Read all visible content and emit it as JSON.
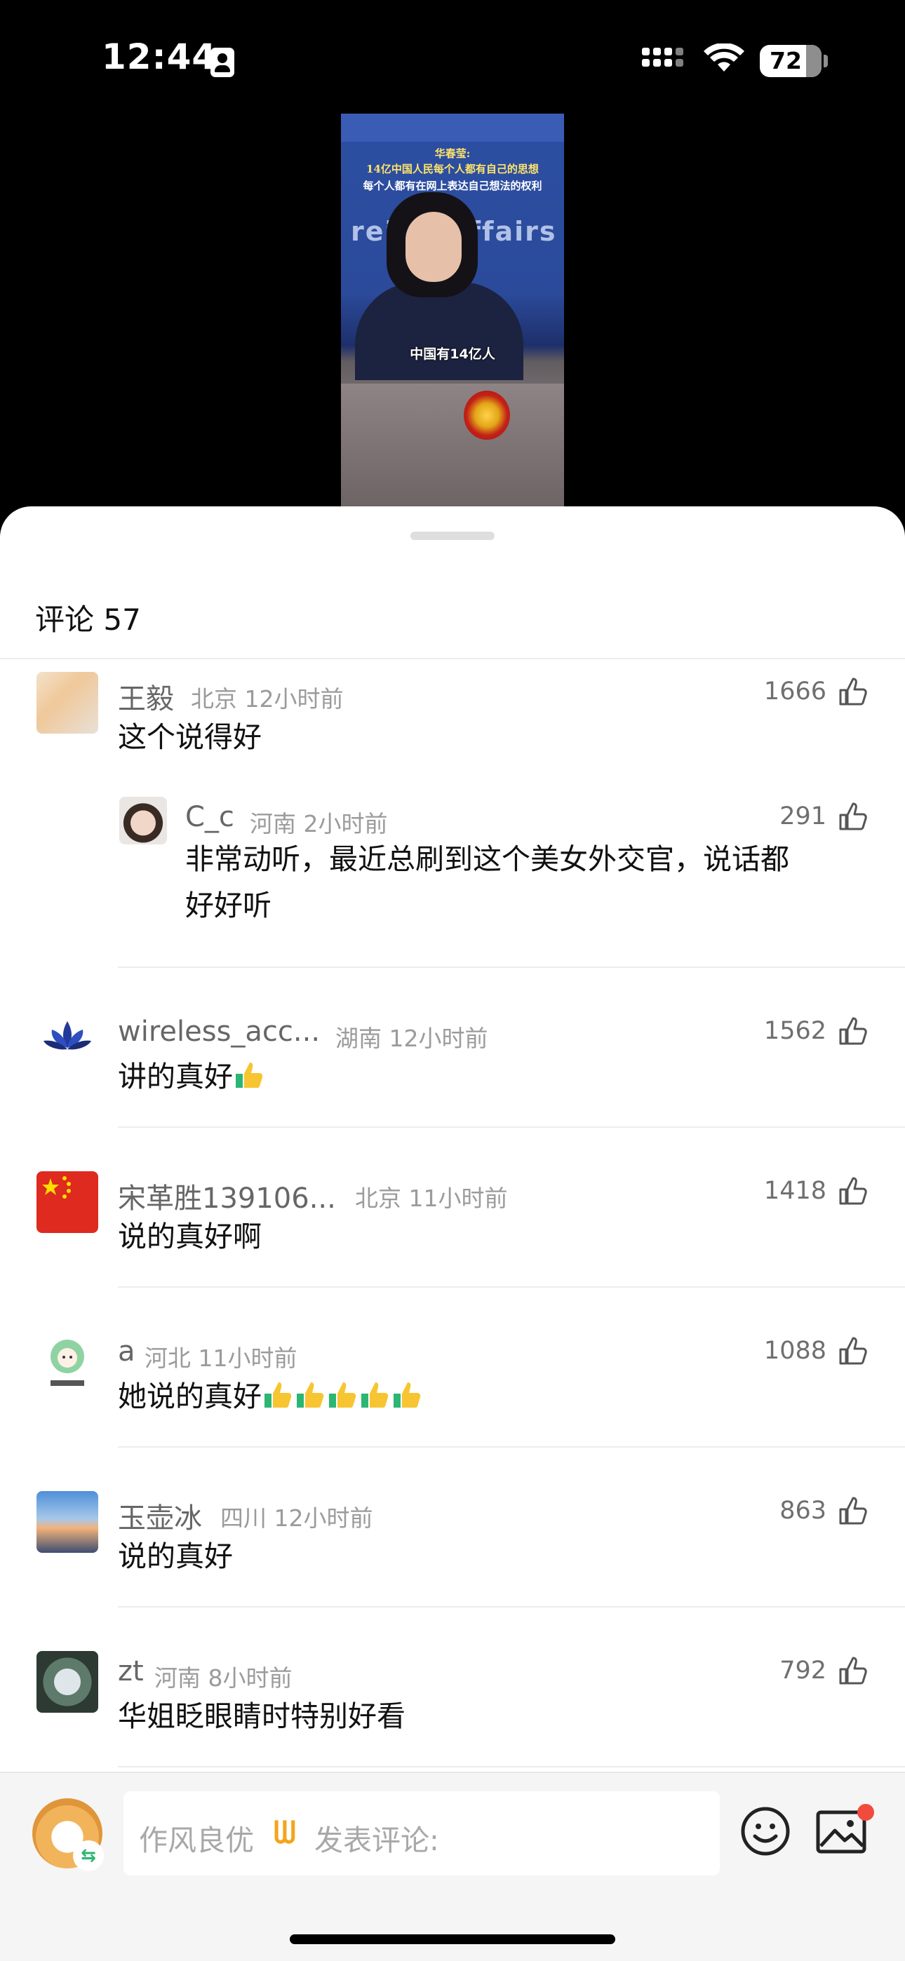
{
  "status_bar": {
    "time": "12:44",
    "battery": "72"
  },
  "video": {
    "caption_head": "华春莹:",
    "caption_line1": "14亿中国人民每个人都有自己的思想",
    "caption_line2": "每个人都有在网上表达自己想法的权利",
    "background_text": "reign Affairs",
    "subtitle": "中国有14亿人"
  },
  "comments_header": {
    "title": "评论 57"
  },
  "comments": [
    {
      "name": "王毅",
      "location": "北京",
      "time": "12小时前",
      "likes": "1666",
      "text": "这个说得好"
    },
    {
      "name": "C_c",
      "location": "河南",
      "time": "2小时前",
      "likes": "291",
      "text_line1": "非常动听，最近总刷到这个美女外交官，说话都",
      "text_line2": "好好听",
      "is_reply": true
    },
    {
      "name": "wireless_acc...",
      "location": "湖南",
      "time": "12小时前",
      "likes": "1562",
      "text": "讲的真好"
    },
    {
      "name": "宋革胜139106...",
      "location": "北京",
      "time": "11小时前",
      "likes": "1418",
      "text": "说的真好啊"
    },
    {
      "name": "a",
      "location": "河北",
      "time": "11小时前",
      "likes": "1088",
      "text": "她说的真好"
    },
    {
      "name": "玉壶冰",
      "location": "四川",
      "time": "12小时前",
      "likes": "863",
      "text": "说的真好"
    },
    {
      "name": "zt",
      "location": "河南",
      "time": "8小时前",
      "likes": "792",
      "text": "华姐眨眼睛时特别好看"
    }
  ],
  "input_bar": {
    "prefix": "作风良优",
    "logo": "ᗯ",
    "placeholder": "发表评论:",
    "switch_icon": "⇆"
  },
  "colors": {
    "accent": "#f4a51c",
    "badge_red": "#f24a3d",
    "thumb_green": "#2bb673"
  }
}
